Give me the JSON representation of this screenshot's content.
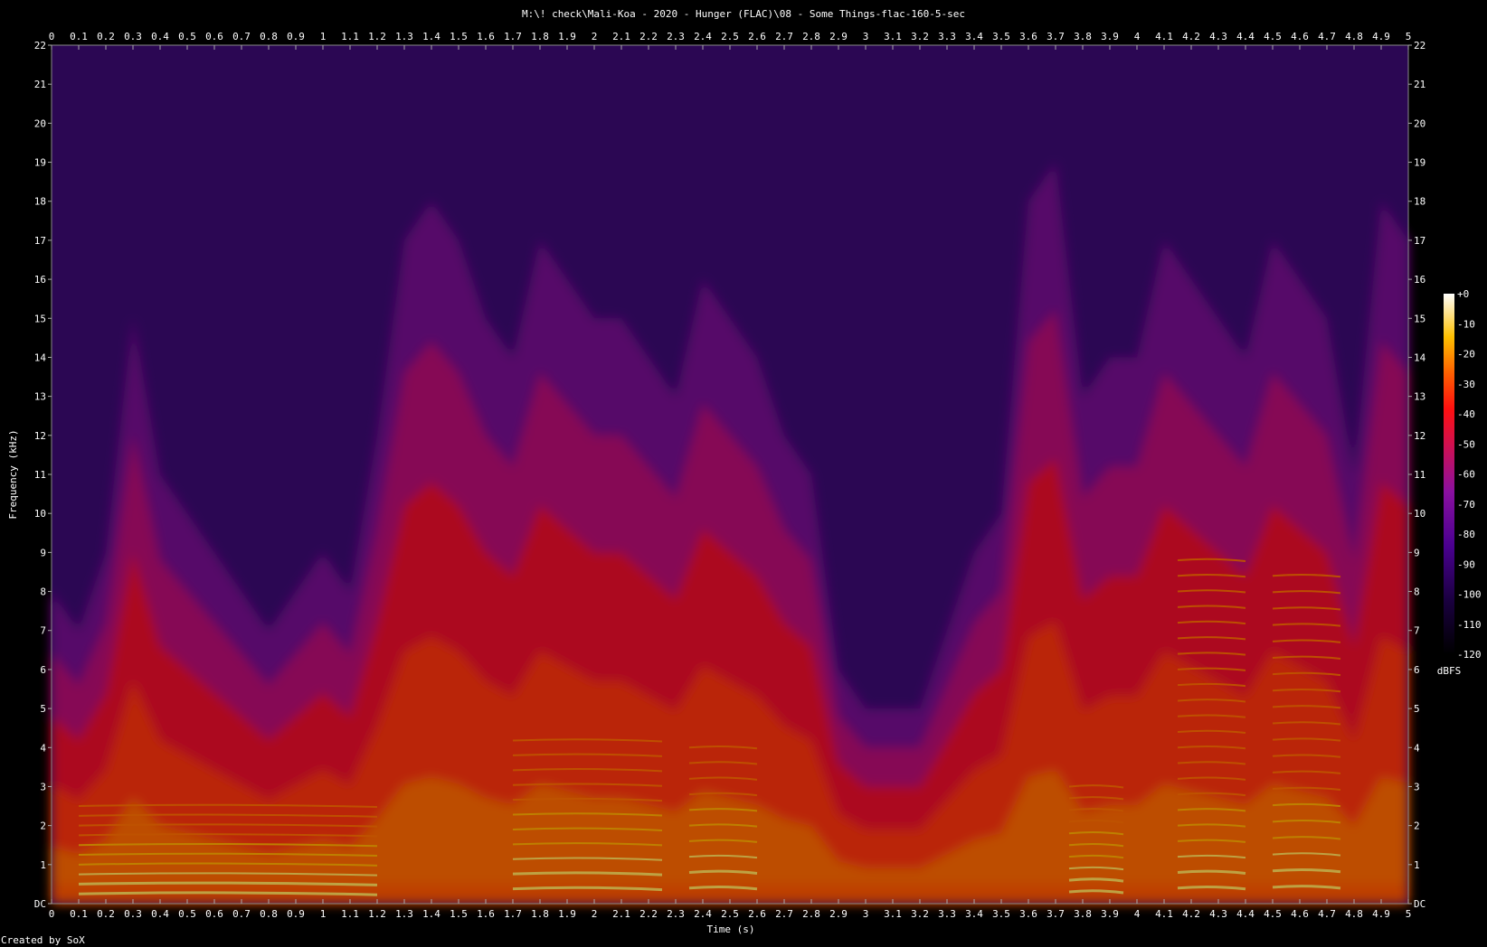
{
  "window": {
    "title": "M:\\! check\\Mali-Koa - 2020 - Hunger (FLAC)\\08 - Some Things-flac-160-5-sec",
    "footer": "Created by SoX"
  },
  "chart_data": {
    "type": "heatmap",
    "title": "M:\\! check\\Mali-Koa - 2020 - Hunger (FLAC)\\08 - Some Things-flac-160-5-sec",
    "xlabel": "Time (s)",
    "ylabel": "Frequency (kHz)",
    "xlim": [
      0,
      5
    ],
    "ylim": [
      0,
      22
    ],
    "x_ticks": [
      "0",
      "0.1",
      "0.2",
      "0.3",
      "0.4",
      "0.5",
      "0.6",
      "0.7",
      "0.8",
      "0.9",
      "1",
      "1.1",
      "1.2",
      "1.3",
      "1.4",
      "1.5",
      "1.6",
      "1.7",
      "1.8",
      "1.9",
      "2",
      "2.1",
      "2.2",
      "2.3",
      "2.4",
      "2.5",
      "2.6",
      "2.7",
      "2.8",
      "2.9",
      "3",
      "3.1",
      "3.2",
      "3.3",
      "3.4",
      "3.5",
      "3.6",
      "3.7",
      "3.8",
      "3.9",
      "4",
      "4.1",
      "4.2",
      "4.3",
      "4.4",
      "4.5",
      "4.6",
      "4.7",
      "4.8",
      "4.9",
      "5"
    ],
    "y_ticks": [
      "DC",
      "1",
      "2",
      "3",
      "4",
      "5",
      "6",
      "7",
      "8",
      "9",
      "10",
      "11",
      "12",
      "13",
      "14",
      "15",
      "16",
      "17",
      "18",
      "19",
      "20",
      "21",
      "22"
    ],
    "colorbar": {
      "label": "dBFS",
      "range": [
        -120,
        0
      ],
      "ticks": [
        "+0",
        "-10",
        "-20",
        "-30",
        "-40",
        "-50",
        "-60",
        "-70",
        "-80",
        "-90",
        "-100",
        "-110",
        "-120"
      ]
    },
    "energy_profile": {
      "times": [
        0,
        0.1,
        0.2,
        0.3,
        0.4,
        0.5,
        0.6,
        0.7,
        0.8,
        0.9,
        1,
        1.1,
        1.2,
        1.3,
        1.4,
        1.5,
        1.6,
        1.7,
        1.8,
        1.9,
        2,
        2.1,
        2.2,
        2.3,
        2.4,
        2.5,
        2.6,
        2.7,
        2.8,
        2.9,
        3,
        3.1,
        3.2,
        3.3,
        3.4,
        3.5,
        3.6,
        3.7,
        3.8,
        3.9,
        4,
        4.1,
        4.2,
        4.3,
        4.4,
        4.5,
        4.6,
        4.7,
        4.8,
        4.9,
        5
      ],
      "upper_extent_khz": [
        8,
        7,
        9,
        15,
        11,
        10,
        9,
        8,
        7,
        8,
        9,
        8,
        12,
        17,
        18,
        17,
        15,
        14,
        17,
        16,
        15,
        15,
        14,
        13,
        16,
        15,
        14,
        12,
        11,
        6,
        5,
        5,
        5,
        7,
        9,
        10,
        18,
        19,
        13,
        14,
        14,
        17,
        16,
        15,
        14,
        17,
        16,
        15,
        11,
        18,
        17
      ]
    },
    "harmonic_segments": [
      {
        "t": [
          0.1,
          1.2
        ],
        "f0_khz": 0.25,
        "harmonics": 10
      },
      {
        "t": [
          1.7,
          2.25
        ],
        "f0_khz": 0.38,
        "harmonics": 11
      },
      {
        "t": [
          2.35,
          2.6
        ],
        "f0_khz": 0.4,
        "harmonics": 10
      },
      {
        "t": [
          3.75,
          3.95
        ],
        "f0_khz": 0.3,
        "harmonics": 10
      },
      {
        "t": [
          4.15,
          4.4
        ],
        "f0_khz": 0.4,
        "harmonics": 22
      },
      {
        "t": [
          4.5,
          4.75
        ],
        "f0_khz": 0.42,
        "harmonics": 20
      }
    ]
  }
}
